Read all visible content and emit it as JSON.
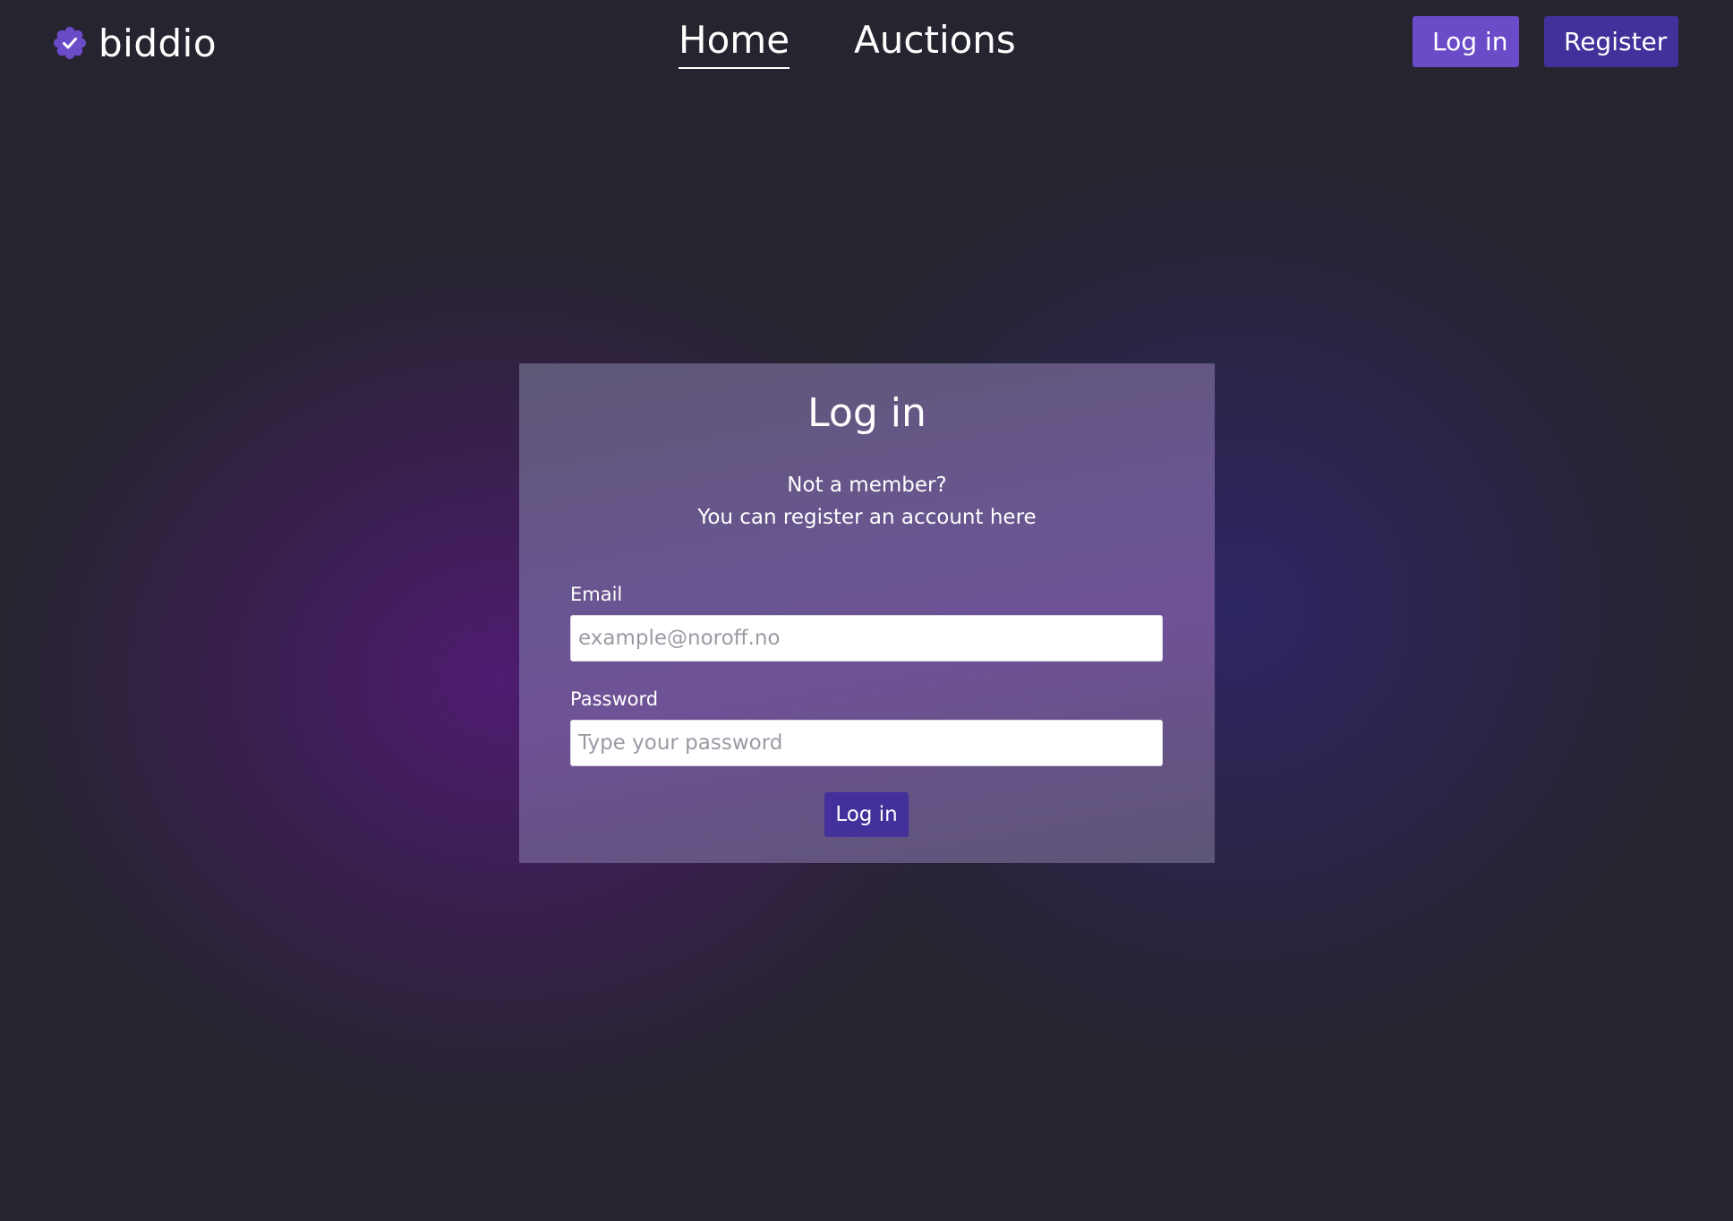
{
  "brand": {
    "name": "biddio",
    "icon": "badge-check-icon",
    "accent_color": "#6a4bc8"
  },
  "nav": {
    "home": "Home",
    "auctions": "Auctions"
  },
  "header_actions": {
    "login": "Log in",
    "register": "Register"
  },
  "login_form": {
    "title": "Log in",
    "subtitle_line1": "Not a member?",
    "subtitle_line2": "You can register an account here",
    "email_label": "Email",
    "email_placeholder": "example@noroff.no",
    "email_value": "",
    "password_label": "Password",
    "password_placeholder": "Type your password",
    "password_value": "",
    "submit_label": "Log in"
  },
  "colors": {
    "background": "#25242f",
    "primary_button": "#6a4bc8",
    "secondary_button": "#43309a"
  }
}
